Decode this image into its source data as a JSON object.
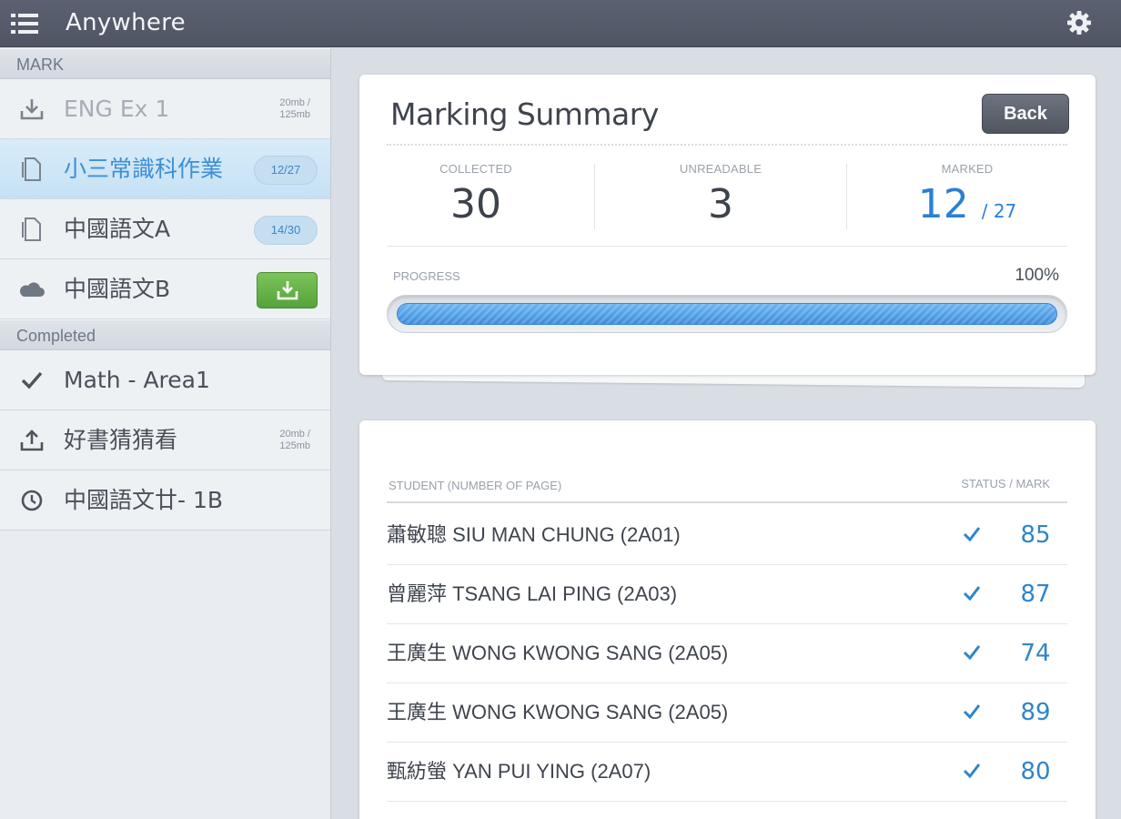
{
  "app": {
    "title": "Anywhere"
  },
  "sidebar": {
    "sections": [
      {
        "header": "MARK",
        "items": [
          {
            "label": "ENG Ex 1",
            "icon": "download-icon",
            "note": "20mb / 125mb",
            "state": "muted"
          },
          {
            "label": "小三常識科作業",
            "icon": "document-icon",
            "badge": "12/27",
            "state": "active"
          },
          {
            "label": "中國語文A",
            "icon": "document-icon",
            "badge": "14/30"
          },
          {
            "label": "中國語文B",
            "icon": "cloud-icon",
            "action": "download-button"
          }
        ]
      },
      {
        "header": "Completed",
        "items": [
          {
            "label": "Math - Area1",
            "icon": "checkmark-icon"
          },
          {
            "label": "好書猜猜看",
            "icon": "upload-icon",
            "note": "20mb / 125mb"
          },
          {
            "label": "中國語文廿- 1B",
            "icon": "clock-icon"
          }
        ]
      }
    ]
  },
  "summary": {
    "title": "Marking Summary",
    "back_label": "Back",
    "collected": {
      "label": "COLLECTED",
      "value": "30"
    },
    "unreadable": {
      "label": "UNREADABLE",
      "value": "3"
    },
    "marked": {
      "label": "MARKED",
      "value": "12",
      "total": "/ 27"
    },
    "progress": {
      "label": "PROGRESS",
      "value_text": "100%",
      "fraction": 1.0
    }
  },
  "students": {
    "col_student": "STUDENT (NUMBER OF PAGE)",
    "col_status": "STATUS / MARK",
    "rows": [
      {
        "name": "蕭敏聰 SIU MAN CHUNG (2A01)",
        "status": "check-icon",
        "mark": "85"
      },
      {
        "name": "曾麗萍 TSANG LAI PING (2A03)",
        "status": "check-icon",
        "mark": "87"
      },
      {
        "name": "王廣生 WONG KWONG SANG (2A05)",
        "status": "check-icon",
        "mark": "74"
      },
      {
        "name": "王廣生 WONG KWONG SANG (2A05)",
        "status": "check-icon",
        "mark": "89"
      },
      {
        "name": "甄紡螢 YAN PUI YING (2A07)",
        "status": "check-icon",
        "mark": "80"
      }
    ]
  },
  "colors": {
    "topbar": "#535a67",
    "accent_blue": "#2b80d4",
    "download_green": "#5fae42"
  }
}
